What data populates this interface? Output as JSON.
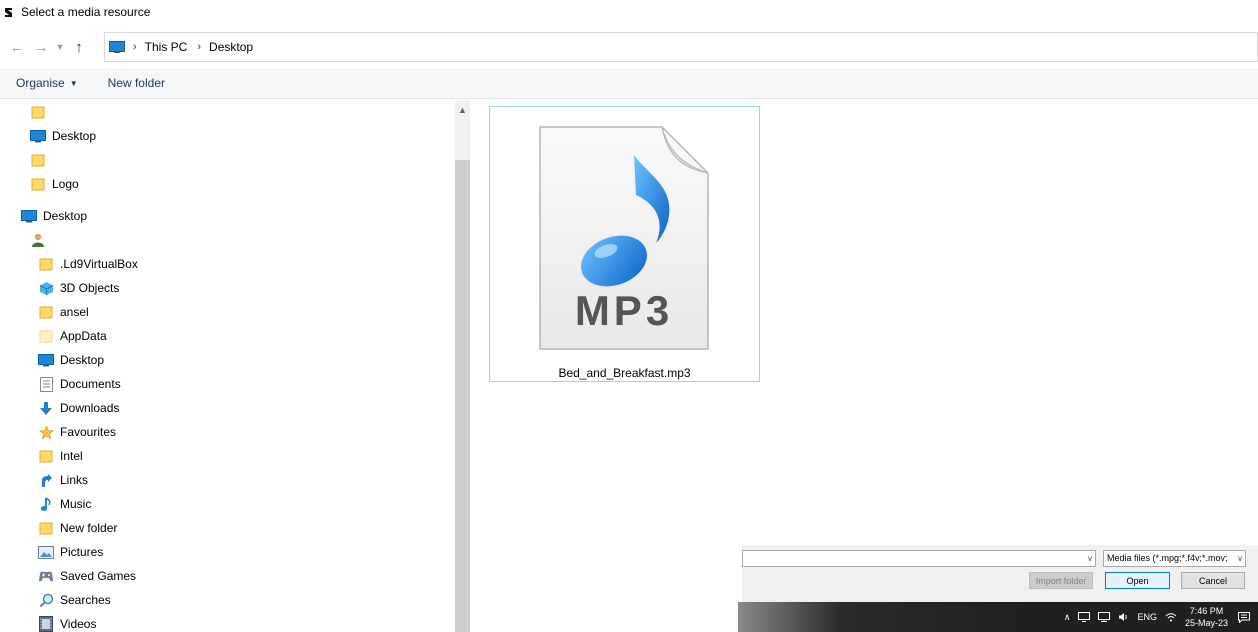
{
  "window": {
    "title": "Select a media resource"
  },
  "address": {
    "crumbs": [
      "This PC",
      "Desktop"
    ]
  },
  "toolbar": {
    "organise_label": "Organise",
    "new_folder_label": "New folder"
  },
  "nav": {
    "items": [
      {
        "label": "",
        "icon": "folder-icon"
      },
      {
        "label": "Desktop",
        "icon": "desktop-icon"
      },
      {
        "label": "",
        "icon": "folder-icon"
      },
      {
        "label": "Logo",
        "icon": "folder-icon"
      },
      {
        "label": "Desktop",
        "icon": "desktop-icon"
      },
      {
        "label": "",
        "icon": "user-icon"
      },
      {
        "label": ".Ld9VirtualBox",
        "icon": "folder-icon"
      },
      {
        "label": "3D Objects",
        "icon": "3d-objects-icon"
      },
      {
        "label": "ansel",
        "icon": "folder-icon"
      },
      {
        "label": "AppData",
        "icon": "folder-icon"
      },
      {
        "label": "Desktop",
        "icon": "desktop-icon"
      },
      {
        "label": "Documents",
        "icon": "documents-icon"
      },
      {
        "label": "Downloads",
        "icon": "downloads-icon"
      },
      {
        "label": "Favourites",
        "icon": "star-icon"
      },
      {
        "label": "Intel",
        "icon": "folder-icon"
      },
      {
        "label": "Links",
        "icon": "links-icon"
      },
      {
        "label": "Music",
        "icon": "music-icon"
      },
      {
        "label": "New folder",
        "icon": "folder-icon"
      },
      {
        "label": "Pictures",
        "icon": "pictures-icon"
      },
      {
        "label": "Saved Games",
        "icon": "saved-games-icon"
      },
      {
        "label": "Searches",
        "icon": "search-icon"
      },
      {
        "label": "Videos",
        "icon": "videos-icon"
      }
    ]
  },
  "files": [
    {
      "name": "Bed_and_Breakfast.mp3",
      "type_label": "MP3",
      "icon": "mp3-file-icon"
    }
  ],
  "footer": {
    "file_name_value": "",
    "filter_label": "Media files (*.mpg;*.f4v;*.mov;",
    "import_folder_label": "Import folder",
    "open_label": "Open",
    "cancel_label": "Cancel"
  },
  "taskbar": {
    "language": "ENG",
    "time": "7:46 PM",
    "date": "25-May-23"
  },
  "colors": {
    "selection_border": "#99d1ff",
    "accent": "#0078d7",
    "folder": "#ffd968",
    "music_note": "#1e88d6"
  }
}
